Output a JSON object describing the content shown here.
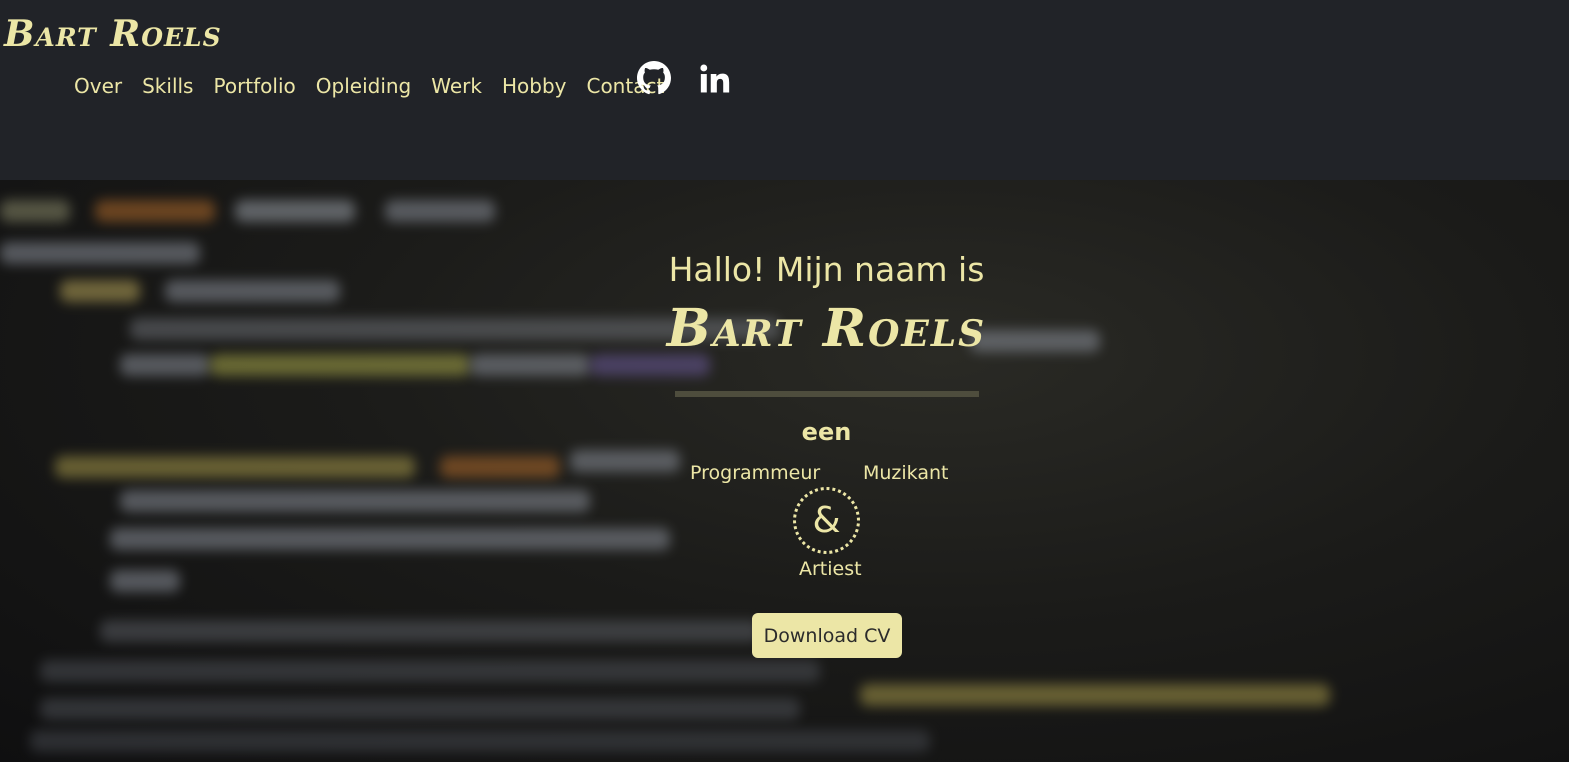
{
  "header": {
    "brand": "Bart Roels",
    "nav": [
      "Over",
      "Skills",
      "Portfolio",
      "Opleiding",
      "Werk",
      "Hobby",
      "Contact"
    ],
    "social": [
      {
        "icon": "github-icon"
      },
      {
        "icon": "linkedin-icon"
      }
    ]
  },
  "hero": {
    "intro": "Hallo! Mijn naam is",
    "name": "Bart Roels",
    "een": "een",
    "roles": {
      "left": "Programmeur",
      "right": "Muzikant",
      "bottom": "Artiest"
    },
    "ampersand": "&",
    "cv_button": "Download CV"
  },
  "colors": {
    "accent": "#ece6a6",
    "header_bg": "#212328",
    "hero_bg": "#141414"
  }
}
